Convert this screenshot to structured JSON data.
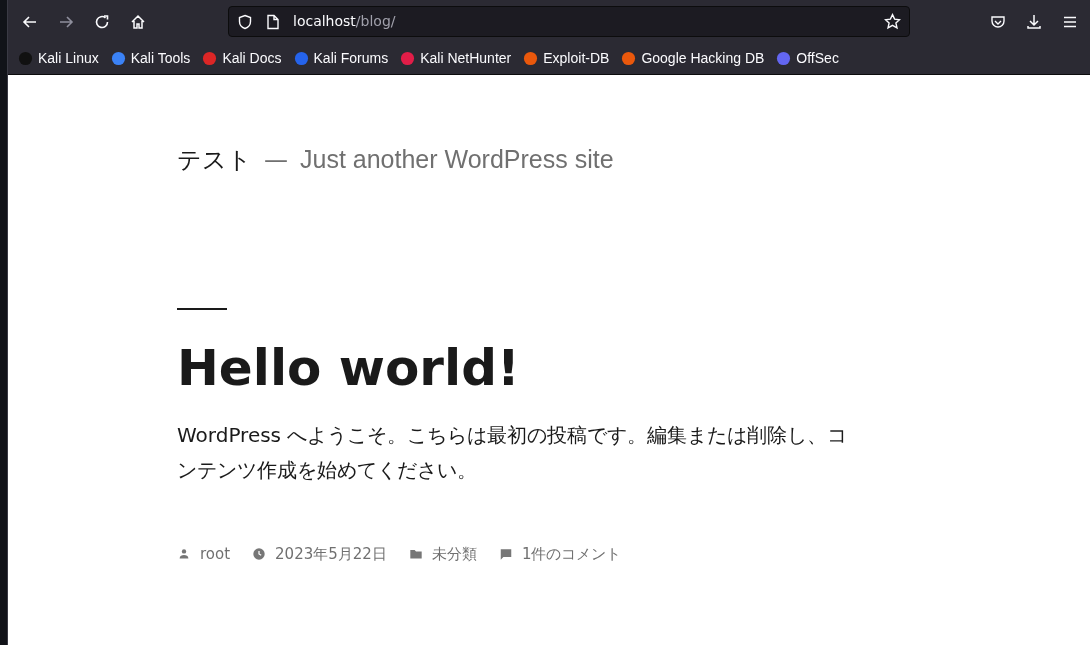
{
  "browser": {
    "url_host": "localhost",
    "url_path": "/blog/",
    "bookmarks": [
      {
        "label": "Kali Linux",
        "color": "#111111"
      },
      {
        "label": "Kali Tools",
        "color": "#3b82f6"
      },
      {
        "label": "Kali Docs",
        "color": "#dc2626"
      },
      {
        "label": "Kali Forums",
        "color": "#2563eb"
      },
      {
        "label": "Kali NetHunter",
        "color": "#e11d48"
      },
      {
        "label": "Exploit-DB",
        "color": "#ea580c"
      },
      {
        "label": "Google Hacking DB",
        "color": "#ea580c"
      },
      {
        "label": "OffSec",
        "color": "#6366f1"
      }
    ]
  },
  "site": {
    "title": "テスト",
    "separator": "—",
    "tagline": "Just another WordPress site"
  },
  "post": {
    "title": "Hello world!",
    "body": "WordPress へようこそ。こちらは最初の投稿です。編集または削除し、コンテンツ作成を始めてください。",
    "meta": [
      {
        "kind": "author",
        "text": "root"
      },
      {
        "kind": "date",
        "text": "2023年5月22日"
      },
      {
        "kind": "category",
        "text": "未分類"
      },
      {
        "kind": "comments",
        "text": "1件のコメント"
      }
    ]
  }
}
